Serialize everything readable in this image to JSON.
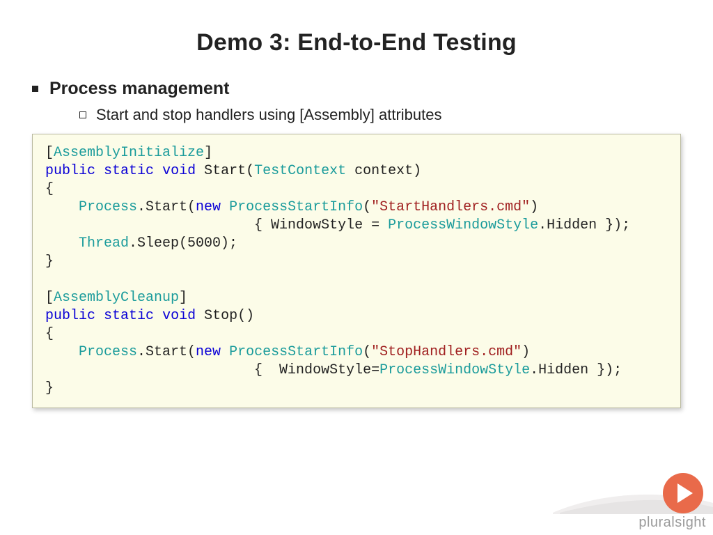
{
  "title": "Demo 3: End-to-End Testing",
  "bullets": {
    "l1": "Process management",
    "l2": "Start and stop handlers using [Assembly] attributes"
  },
  "code": {
    "tokens": [
      {
        "t": "[",
        "c": "punc"
      },
      {
        "t": "AssemblyInitialize",
        "c": "type"
      },
      {
        "t": "]",
        "c": "punc"
      },
      {
        "t": "\n",
        "c": "punc"
      },
      {
        "t": "public",
        "c": "kw"
      },
      {
        "t": " ",
        "c": "punc"
      },
      {
        "t": "static",
        "c": "kw"
      },
      {
        "t": " ",
        "c": "punc"
      },
      {
        "t": "void",
        "c": "kw"
      },
      {
        "t": " Start(",
        "c": "punc"
      },
      {
        "t": "TestContext",
        "c": "type"
      },
      {
        "t": " context)",
        "c": "punc"
      },
      {
        "t": "\n",
        "c": "punc"
      },
      {
        "t": "{",
        "c": "punc"
      },
      {
        "t": "\n",
        "c": "punc"
      },
      {
        "t": "    ",
        "c": "punc"
      },
      {
        "t": "Process",
        "c": "type"
      },
      {
        "t": ".Start(",
        "c": "punc"
      },
      {
        "t": "new",
        "c": "kw"
      },
      {
        "t": " ",
        "c": "punc"
      },
      {
        "t": "ProcessStartInfo",
        "c": "type"
      },
      {
        "t": "(",
        "c": "punc"
      },
      {
        "t": "\"StartHandlers.cmd\"",
        "c": "str"
      },
      {
        "t": ")",
        "c": "punc"
      },
      {
        "t": "\n",
        "c": "punc"
      },
      {
        "t": "                         { WindowStyle = ",
        "c": "punc"
      },
      {
        "t": "ProcessWindowStyle",
        "c": "type"
      },
      {
        "t": ".Hidden });",
        "c": "punc"
      },
      {
        "t": "\n",
        "c": "punc"
      },
      {
        "t": "    ",
        "c": "punc"
      },
      {
        "t": "Thread",
        "c": "type"
      },
      {
        "t": ".Sleep(5000);",
        "c": "punc"
      },
      {
        "t": "\n",
        "c": "punc"
      },
      {
        "t": "}",
        "c": "punc"
      },
      {
        "t": "\n",
        "c": "punc"
      },
      {
        "t": "\n",
        "c": "punc"
      },
      {
        "t": "[",
        "c": "punc"
      },
      {
        "t": "AssemblyCleanup",
        "c": "type"
      },
      {
        "t": "]",
        "c": "punc"
      },
      {
        "t": "\n",
        "c": "punc"
      },
      {
        "t": "public",
        "c": "kw"
      },
      {
        "t": " ",
        "c": "punc"
      },
      {
        "t": "static",
        "c": "kw"
      },
      {
        "t": " ",
        "c": "punc"
      },
      {
        "t": "void",
        "c": "kw"
      },
      {
        "t": " Stop()",
        "c": "punc"
      },
      {
        "t": "\n",
        "c": "punc"
      },
      {
        "t": "{",
        "c": "punc"
      },
      {
        "t": "\n",
        "c": "punc"
      },
      {
        "t": "    ",
        "c": "punc"
      },
      {
        "t": "Process",
        "c": "type"
      },
      {
        "t": ".Start(",
        "c": "punc"
      },
      {
        "t": "new",
        "c": "kw"
      },
      {
        "t": " ",
        "c": "punc"
      },
      {
        "t": "ProcessStartInfo",
        "c": "type"
      },
      {
        "t": "(",
        "c": "punc"
      },
      {
        "t": "\"StopHandlers.cmd\"",
        "c": "str"
      },
      {
        "t": ")",
        "c": "punc"
      },
      {
        "t": "\n",
        "c": "punc"
      },
      {
        "t": "                         {  WindowStyle=",
        "c": "punc"
      },
      {
        "t": "ProcessWindowStyle",
        "c": "type"
      },
      {
        "t": ".Hidden });",
        "c": "punc"
      },
      {
        "t": "\n",
        "c": "punc"
      },
      {
        "t": "}",
        "c": "punc"
      }
    ]
  },
  "brand": {
    "name": "pluralsight"
  }
}
